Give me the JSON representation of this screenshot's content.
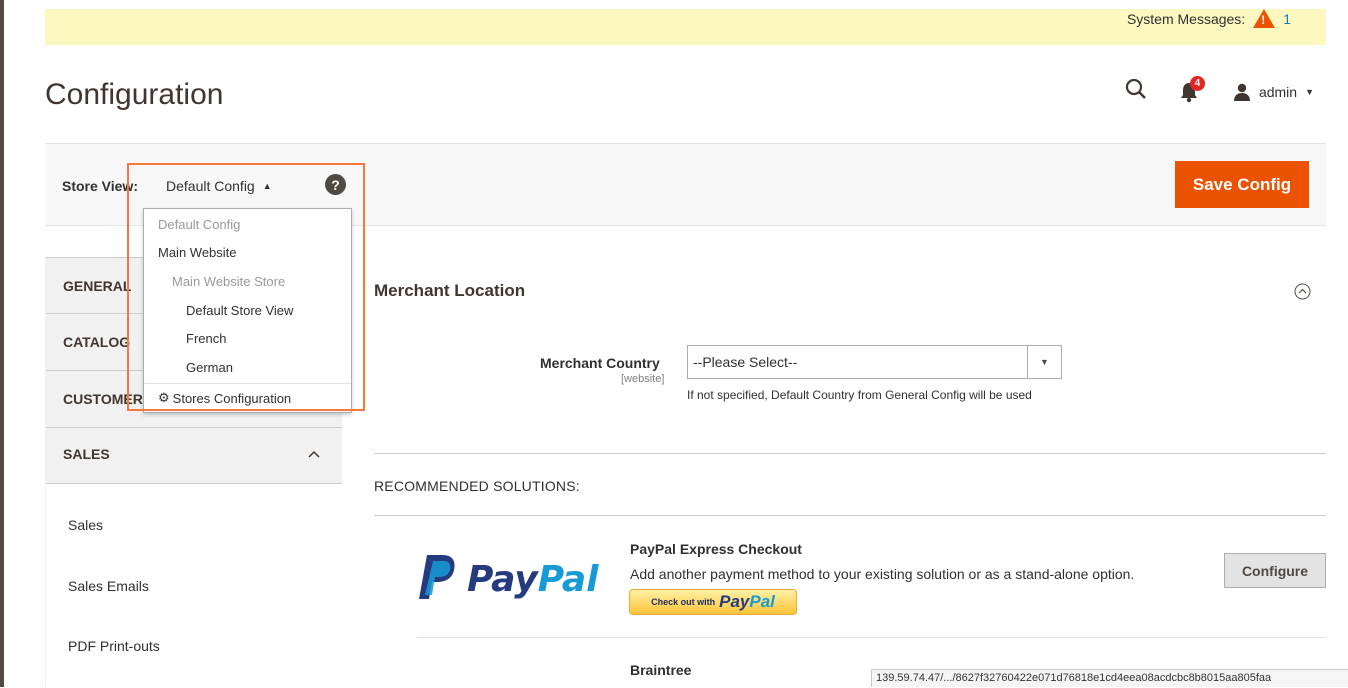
{
  "system_messages": {
    "label": "System Messages:",
    "count": "1"
  },
  "page": {
    "title": "Configuration"
  },
  "header": {
    "user": "admin",
    "notifications_count": "4"
  },
  "toolbar": {
    "store_view_label": "Store View:",
    "scope_value": "Default Config",
    "help_glyph": "?",
    "save_label": "Save Config"
  },
  "scope_dropdown": {
    "items": [
      {
        "label": "Default Config",
        "disabled": true
      },
      {
        "label": "Main Website",
        "disabled": false
      },
      {
        "label": "Main Website Store",
        "disabled": true
      },
      {
        "label": "Default Store View",
        "disabled": false
      },
      {
        "label": "French",
        "disabled": false
      },
      {
        "label": "German",
        "disabled": false
      }
    ],
    "stores_config": "Stores Configuration"
  },
  "sidebar": {
    "tabs": [
      {
        "label": "GENERAL"
      },
      {
        "label": "CATALOG"
      },
      {
        "label": "CUSTOMERS"
      },
      {
        "label": "SALES"
      }
    ],
    "sales_items": [
      "Sales",
      "Sales Emails",
      "PDF Print-outs"
    ]
  },
  "main": {
    "section_title": "Merchant Location",
    "merchant_country": {
      "label": "Merchant Country",
      "scope": "[website]",
      "value": "--Please Select--",
      "note": "If not specified, Default Country from General Config will be used"
    },
    "recommended_label": "RECOMMENDED SOLUTIONS:",
    "paypal": {
      "logo_pay": "Pay",
      "logo_pal": "Pal",
      "title": "PayPal Express Checkout",
      "description": "Add another payment method to your existing solution or as a stand-alone option.",
      "checkout_small": "Check out with",
      "checkout_pay": "Pay",
      "checkout_pal": "Pal",
      "configure_label": "Configure"
    },
    "braintree": {
      "title": "Braintree"
    }
  },
  "status_bar": {
    "url": "139.59.74.47/.../8627f32760422e071d76818e1cd4eea08acdcbc8b8015aa805faa"
  },
  "colors": {
    "accent": "#eb5202",
    "highlight": "#f5793c",
    "notice_bg": "#fdf7c0",
    "paypal_dark": "#253b80",
    "paypal_light": "#179bd7"
  }
}
